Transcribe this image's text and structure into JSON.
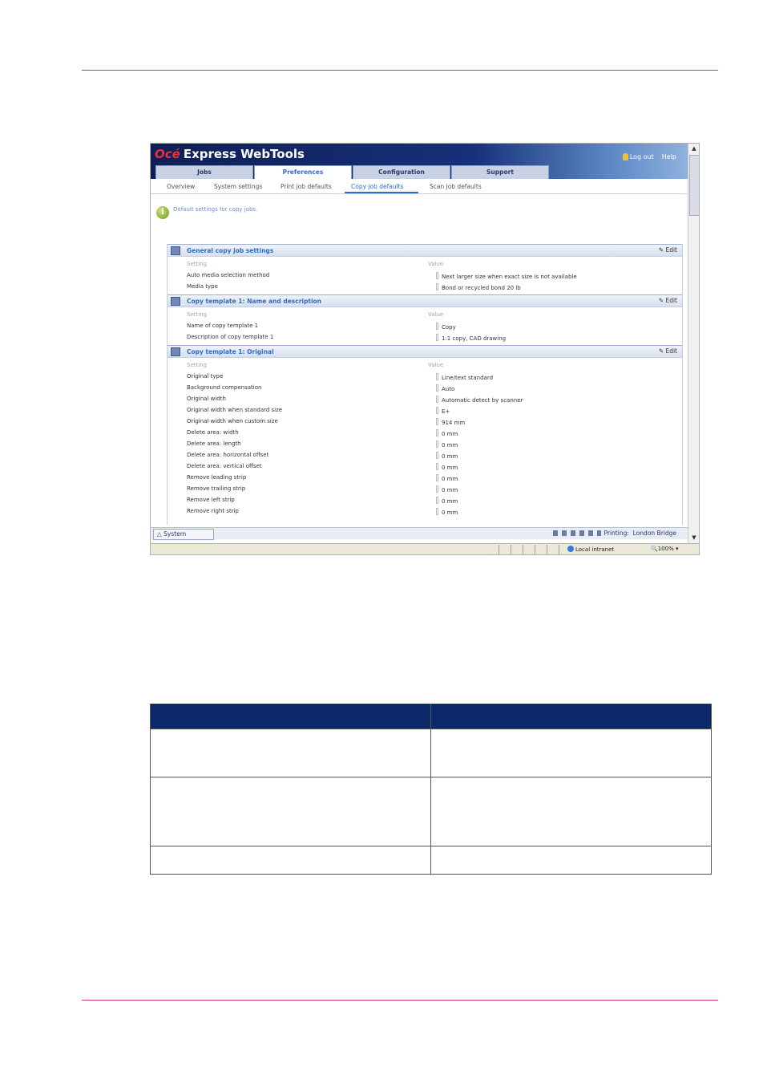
{
  "app": {
    "brand_logo": "Océ",
    "brand_title": "Express WebTools",
    "logout_label": "Log out",
    "help_label": "Help"
  },
  "tabs": [
    {
      "label": "Jobs"
    },
    {
      "label": "Preferences"
    },
    {
      "label": "Configuration"
    },
    {
      "label": "Support"
    }
  ],
  "subtabs": [
    {
      "label": "Overview"
    },
    {
      "label": "System settings"
    },
    {
      "label": "Print job defaults"
    },
    {
      "label": "Copy job defaults"
    },
    {
      "label": "Scan job defaults"
    }
  ],
  "info_text": "Default settings for copy jobs.",
  "edit_label": "Edit",
  "sections": [
    {
      "title": "General copy job settings",
      "header": {
        "setting": "Setting",
        "value": "Value"
      },
      "rows": [
        {
          "setting": "Auto media selection method",
          "value": "Next larger size when exact size is not available"
        },
        {
          "setting": "Media type",
          "value": "Bond or recycled bond 20 lb"
        }
      ]
    },
    {
      "title": "Copy template 1: Name and description",
      "header": {
        "setting": "Setting",
        "value": "Value"
      },
      "rows": [
        {
          "setting": "Name of copy template 1",
          "value": "Copy"
        },
        {
          "setting": "Description of copy template 1",
          "value": "1:1 copy, CAD drawing"
        }
      ]
    },
    {
      "title": "Copy template 1: Original",
      "header": {
        "setting": "Setting",
        "value": "Value"
      },
      "rows": [
        {
          "setting": "Original type",
          "value": "Line/text standard"
        },
        {
          "setting": "Background compensation",
          "value": "Auto"
        },
        {
          "setting": "Original width",
          "value": "Automatic detect by scanner"
        },
        {
          "setting": "Original width when standard size",
          "value": "E+"
        },
        {
          "setting": "Original width when custom size",
          "value": "914 mm"
        },
        {
          "setting": "Delete area: width",
          "value": "0 mm"
        },
        {
          "setting": "Delete area: length",
          "value": "0 mm"
        },
        {
          "setting": "Delete area: horizontal offset",
          "value": "0 mm"
        },
        {
          "setting": "Delete area: vertical offset",
          "value": "0 mm"
        },
        {
          "setting": "Remove leading strip",
          "value": "0 mm"
        },
        {
          "setting": "Remove trailing strip",
          "value": "0 mm"
        },
        {
          "setting": "Remove left strip",
          "value": "0 mm"
        },
        {
          "setting": "Remove right strip",
          "value": "0 mm"
        }
      ]
    }
  ],
  "status": {
    "system_tab": "System",
    "printing_label": "Printing:",
    "printer_name": "London Bridge"
  },
  "browser": {
    "zone": "Local intranet",
    "zoom": "100%"
  },
  "colors": {
    "rule": "#d6336c",
    "table_header": "#0c2a6a",
    "link_blue": "#2f6cc8"
  }
}
